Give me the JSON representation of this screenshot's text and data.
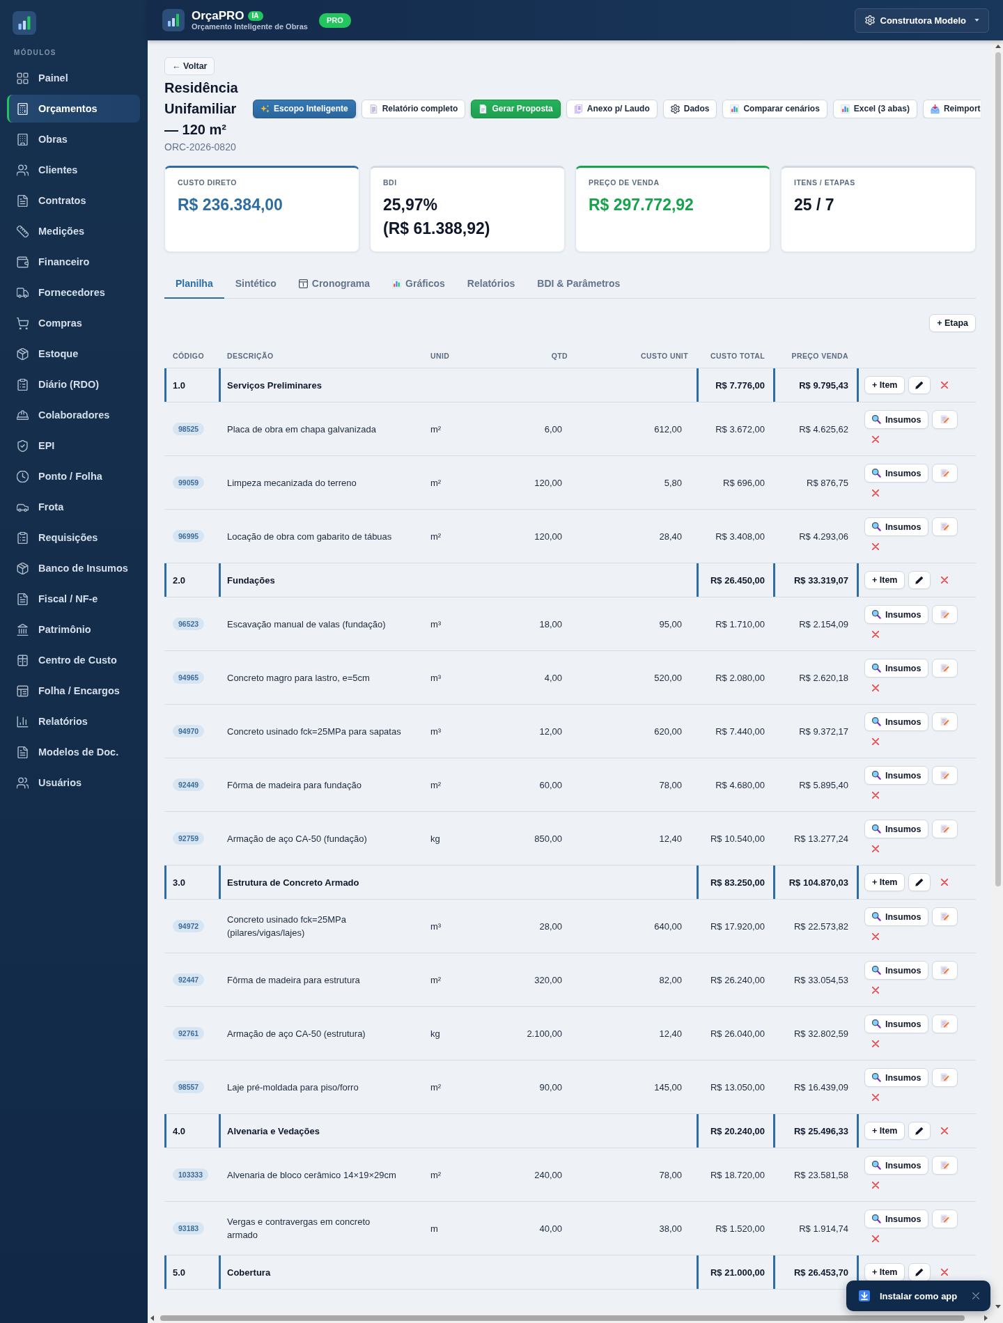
{
  "sidebar": {
    "section_label": "MÓDULOS",
    "items": [
      {
        "label": "Painel",
        "selected": false
      },
      {
        "label": "Orçamentos",
        "selected": true
      },
      {
        "label": "Obras",
        "selected": false
      },
      {
        "label": "Clientes",
        "selected": false
      },
      {
        "label": "Contratos",
        "selected": false
      },
      {
        "label": "Medições",
        "selected": false
      },
      {
        "label": "Financeiro",
        "selected": false
      },
      {
        "label": "Fornecedores",
        "selected": false
      },
      {
        "label": "Compras",
        "selected": false
      },
      {
        "label": "Estoque",
        "selected": false
      },
      {
        "label": "Diário (RDO)",
        "selected": false
      },
      {
        "label": "Colaboradores",
        "selected": false
      },
      {
        "label": "EPI",
        "selected": false
      },
      {
        "label": "Ponto / Folha",
        "selected": false
      },
      {
        "label": "Frota",
        "selected": false
      },
      {
        "label": "Requisições",
        "selected": false
      },
      {
        "label": "Banco de Insumos",
        "selected": false
      },
      {
        "label": "Fiscal / NF-e",
        "selected": false
      },
      {
        "label": "Patrimônio",
        "selected": false
      },
      {
        "label": "Centro de Custo",
        "selected": false
      },
      {
        "label": "Folha / Encargos",
        "selected": false
      },
      {
        "label": "Relatórios",
        "selected": false
      },
      {
        "label": "Modelos de Doc.",
        "selected": false
      },
      {
        "label": "Usuários",
        "selected": false
      }
    ]
  },
  "header": {
    "brand": "OrçaPRO",
    "brand_badge": "IA",
    "tagline": "Orçamento Inteligente de Obras",
    "plan_badge": "PRO",
    "company_button": "Construtora Modelo"
  },
  "page": {
    "back_button": "← Voltar",
    "title": "Residência Unifamiliar — 120 m²",
    "code": "ORC-2026-0820",
    "actions": [
      {
        "label": "Escopo Inteligente",
        "kind": "primary"
      },
      {
        "label": "Relatório completo",
        "kind": "default"
      },
      {
        "label": "Gerar Proposta",
        "kind": "success"
      },
      {
        "label": "Anexo p/ Laudo",
        "kind": "default"
      },
      {
        "label": "Dados",
        "kind": "default"
      },
      {
        "label": "Comparar cenários",
        "kind": "default"
      },
      {
        "label": "Excel (3 abas)",
        "kind": "default"
      },
      {
        "label": "Reimport",
        "kind": "default"
      }
    ]
  },
  "summary_cards": [
    {
      "label": "CUSTO DIRETO",
      "value": "R$ 236.384,00",
      "kind": "primary"
    },
    {
      "label": "BDI",
      "value": "25,97% (R$ 61.388,92)",
      "kind": "neutral"
    },
    {
      "label": "PREÇO DE VENDA",
      "value": "R$ 297.772,92",
      "kind": "success"
    },
    {
      "label": "ITENS / ETAPAS",
      "value": "25 / 7",
      "kind": "neutral"
    }
  ],
  "tabs": [
    {
      "label": "Planilha",
      "selected": true
    },
    {
      "label": "Sintético",
      "selected": false
    },
    {
      "label": "Cronograma",
      "selected": false
    },
    {
      "label": "Gráficos",
      "selected": false
    },
    {
      "label": "Relatórios",
      "selected": false
    },
    {
      "label": "BDI & Parâmetros",
      "selected": false
    }
  ],
  "add_stage_button": "+ Etapa",
  "table": {
    "columns": [
      "CÓDIGO",
      "DESCRIÇÃO",
      "UNID",
      "QTD",
      "CUSTO UNIT",
      "CUSTO TOTAL",
      "PREÇO VENDA"
    ],
    "stages": [
      {
        "code": "1.0",
        "title": "Serviços Preliminares",
        "total_cost": "R$ 7.776,00",
        "sale_price": "R$ 9.795,43",
        "add_item_button": "+ Item",
        "items": [
          {
            "code": "98525",
            "description": "Placa de obra em chapa galvanizada",
            "unit": "m²",
            "qty": "6,00",
            "unit_cost": "612,00",
            "total_cost": "R$ 3.672,00",
            "sale_price": "R$ 4.625,62",
            "inputs_button": "Insumos"
          },
          {
            "code": "99059",
            "description": "Limpeza mecanizada do terreno",
            "unit": "m²",
            "qty": "120,00",
            "unit_cost": "5,80",
            "total_cost": "R$ 696,00",
            "sale_price": "R$ 876,75",
            "inputs_button": "Insumos"
          },
          {
            "code": "96995",
            "description": "Locação de obra com gabarito de tábuas",
            "unit": "m²",
            "qty": "120,00",
            "unit_cost": "28,40",
            "total_cost": "R$ 3.408,00",
            "sale_price": "R$ 4.293,06",
            "inputs_button": "Insumos"
          }
        ]
      },
      {
        "code": "2.0",
        "title": "Fundações",
        "total_cost": "R$ 26.450,00",
        "sale_price": "R$ 33.319,07",
        "add_item_button": "+ Item",
        "items": [
          {
            "code": "96523",
            "description": "Escavação manual de valas (fundação)",
            "unit": "m³",
            "qty": "18,00",
            "unit_cost": "95,00",
            "total_cost": "R$ 1.710,00",
            "sale_price": "R$ 2.154,09",
            "inputs_button": "Insumos"
          },
          {
            "code": "94965",
            "description": "Concreto magro para lastro, e=5cm",
            "unit": "m³",
            "qty": "4,00",
            "unit_cost": "520,00",
            "total_cost": "R$ 2.080,00",
            "sale_price": "R$ 2.620,18",
            "inputs_button": "Insumos"
          },
          {
            "code": "94970",
            "description": "Concreto usinado fck=25MPa para sapatas",
            "unit": "m³",
            "qty": "12,00",
            "unit_cost": "620,00",
            "total_cost": "R$ 7.440,00",
            "sale_price": "R$ 9.372,17",
            "inputs_button": "Insumos"
          },
          {
            "code": "92449",
            "description": "Fôrma de madeira para fundação",
            "unit": "m²",
            "qty": "60,00",
            "unit_cost": "78,00",
            "total_cost": "R$ 4.680,00",
            "sale_price": "R$ 5.895,40",
            "inputs_button": "Insumos"
          },
          {
            "code": "92759",
            "description": "Armação de aço CA-50 (fundação)",
            "unit": "kg",
            "qty": "850,00",
            "unit_cost": "12,40",
            "total_cost": "R$ 10.540,00",
            "sale_price": "R$ 13.277,24",
            "inputs_button": "Insumos"
          }
        ]
      },
      {
        "code": "3.0",
        "title": "Estrutura de Concreto Armado",
        "total_cost": "R$ 83.250,00",
        "sale_price": "R$ 104.870,03",
        "add_item_button": "+ Item",
        "items": [
          {
            "code": "94972",
            "description": "Concreto usinado fck=25MPa (pilares/vigas/lajes)",
            "unit": "m³",
            "qty": "28,00",
            "unit_cost": "640,00",
            "total_cost": "R$ 17.920,00",
            "sale_price": "R$ 22.573,82",
            "inputs_button": "Insumos"
          },
          {
            "code": "92447",
            "description": "Fôrma de madeira para estrutura",
            "unit": "m²",
            "qty": "320,00",
            "unit_cost": "82,00",
            "total_cost": "R$ 26.240,00",
            "sale_price": "R$ 33.054,53",
            "inputs_button": "Insumos"
          },
          {
            "code": "92761",
            "description": "Armação de aço CA-50 (estrutura)",
            "unit": "kg",
            "qty": "2.100,00",
            "unit_cost": "12,40",
            "total_cost": "R$ 26.040,00",
            "sale_price": "R$ 32.802,59",
            "inputs_button": "Insumos"
          },
          {
            "code": "98557",
            "description": "Laje pré-moldada para piso/forro",
            "unit": "m²",
            "qty": "90,00",
            "unit_cost": "145,00",
            "total_cost": "R$ 13.050,00",
            "sale_price": "R$ 16.439,09",
            "inputs_button": "Insumos"
          }
        ]
      },
      {
        "code": "4.0",
        "title": "Alvenaria e Vedações",
        "total_cost": "R$ 20.240,00",
        "sale_price": "R$ 25.496,33",
        "add_item_button": "+ Item",
        "items": [
          {
            "code": "103333",
            "description": "Alvenaria de bloco cerâmico 14×19×29cm",
            "unit": "m²",
            "qty": "240,00",
            "unit_cost": "78,00",
            "total_cost": "R$ 18.720,00",
            "sale_price": "R$ 23.581,58",
            "inputs_button": "Insumos"
          },
          {
            "code": "93183",
            "description": "Vergas e contravergas em concreto armado",
            "unit": "m",
            "qty": "40,00",
            "unit_cost": "38,00",
            "total_cost": "R$ 1.520,00",
            "sale_price": "R$ 1.914,74",
            "inputs_button": "Insumos"
          }
        ]
      },
      {
        "code": "5.0",
        "title": "Cobertura",
        "total_cost": "R$ 21.000,00",
        "sale_price": "R$ 26.453,70",
        "add_item_button": "+ Item"
      }
    ]
  },
  "install_toast": {
    "label": "Instalar como app"
  }
}
